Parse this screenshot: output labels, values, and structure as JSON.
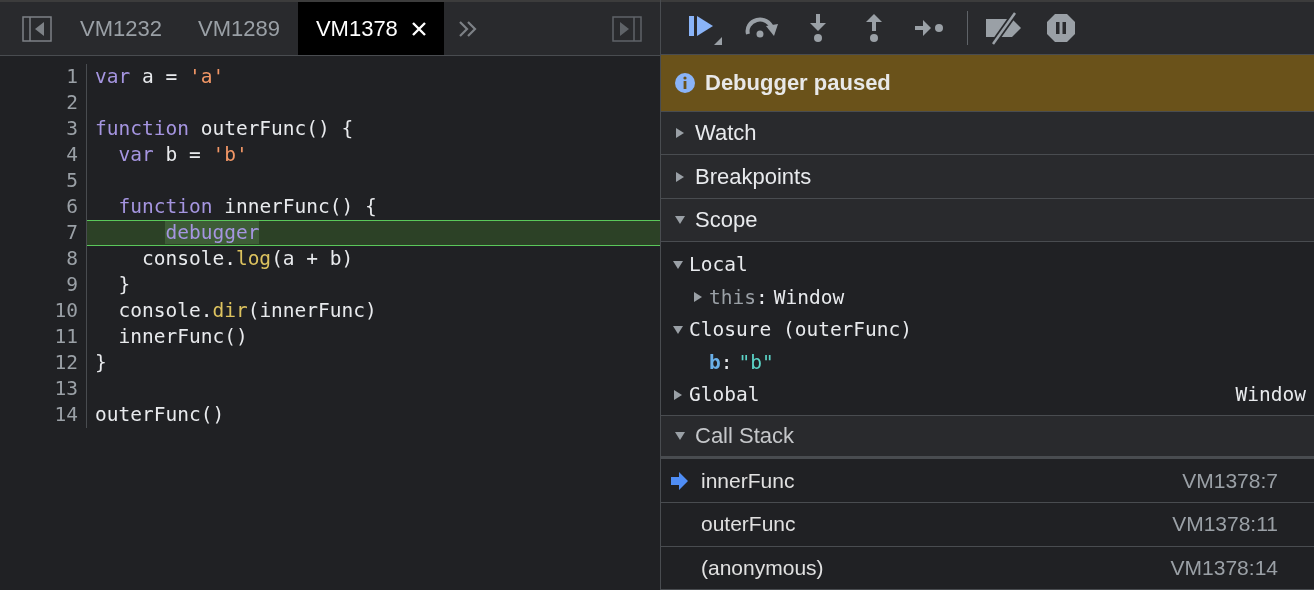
{
  "editor_tabs": [
    {
      "label": "VM1232",
      "selected": false
    },
    {
      "label": "VM1289",
      "selected": false
    },
    {
      "label": "VM1378",
      "selected": true
    }
  ],
  "code": {
    "lines": [
      {
        "number": "1",
        "paused": false,
        "tokens": [
          {
            "text": "var",
            "kind": "keyword"
          },
          {
            "text": " a = ",
            "kind": "plain"
          },
          {
            "text": "'a'",
            "kind": "string"
          }
        ]
      },
      {
        "number": "2",
        "paused": false
      },
      {
        "number": "3",
        "paused": false,
        "tokens": [
          {
            "text": "function",
            "kind": "keyword"
          },
          {
            "text": " outerFunc() {",
            "kind": "plain"
          }
        ]
      },
      {
        "number": "4",
        "paused": false,
        "tokens": [
          {
            "text": "  var",
            "kind": "keyword"
          },
          {
            "text": " b = ",
            "kind": "plain"
          },
          {
            "text": "'b'",
            "kind": "string"
          }
        ]
      },
      {
        "number": "5",
        "paused": false
      },
      {
        "number": "6",
        "paused": false,
        "tokens": [
          {
            "text": "  function",
            "kind": "keyword"
          },
          {
            "text": " innerFunc() {",
            "kind": "plain"
          }
        ]
      },
      {
        "number": "7",
        "paused": true,
        "tokens": [
          {
            "text": "      debugger",
            "kind": "current"
          }
        ]
      },
      {
        "number": "8",
        "paused": false,
        "tokens": [
          {
            "text": "    console.",
            "kind": "plain"
          },
          {
            "text": "log",
            "kind": "method"
          },
          {
            "text": "(a + b)",
            "kind": "plain"
          }
        ]
      },
      {
        "number": "9",
        "paused": false,
        "tokens": [
          {
            "text": "  }",
            "kind": "plain"
          }
        ]
      },
      {
        "number": "10",
        "paused": false,
        "tokens": [
          {
            "text": "  console.",
            "kind": "plain"
          },
          {
            "text": "dir",
            "kind": "method"
          },
          {
            "text": "(innerFunc)",
            "kind": "plain"
          }
        ]
      },
      {
        "number": "11",
        "paused": false,
        "tokens": [
          {
            "text": "  innerFunc()",
            "kind": "plain"
          }
        ]
      },
      {
        "number": "12",
        "paused": false,
        "tokens": [
          {
            "text": "}",
            "kind": "plain"
          }
        ]
      },
      {
        "number": "13",
        "paused": false
      },
      {
        "number": "14",
        "paused": false,
        "tokens": [
          {
            "text": "outerFunc()",
            "kind": "plain"
          }
        ]
      }
    ]
  },
  "status_banner": {
    "text": "Debugger paused"
  },
  "sections": [
    {
      "title": "Watch",
      "expanded": false,
      "kind": "plain"
    },
    {
      "title": "Breakpoints",
      "expanded": false,
      "kind": "plain"
    },
    {
      "title": "Scope",
      "expanded": true,
      "kind": "scope",
      "items": [
        {
          "name": "Local",
          "kind": "scope",
          "expanded": true,
          "children": [
            {
              "name": "this",
              "separator": ":",
              "kind": "special-property",
              "expanded": false,
              "value": {
                "text": "Window",
                "kind": "object"
              }
            }
          ]
        },
        {
          "name": "Closure (outerFunc)",
          "kind": "scope",
          "expanded": true,
          "children": [
            {
              "name": "b",
              "separator": ":",
              "kind": "variable",
              "value": {
                "text": "\"b\"",
                "kind": "string"
              }
            }
          ]
        },
        {
          "name": "Global",
          "kind": "scope",
          "expanded": false,
          "value": {
            "text": "Window",
            "kind": "object"
          }
        }
      ]
    },
    {
      "title": "Call Stack",
      "expanded": true,
      "kind": "call-stack",
      "frames": [
        {
          "function": "innerFunc",
          "location": "VM1378:7",
          "selected": true
        },
        {
          "function": "outerFunc",
          "location": "VM1378:11",
          "selected": false
        },
        {
          "function": "(anonymous)",
          "location": "VM1378:14",
          "selected": false
        }
      ]
    }
  ]
}
